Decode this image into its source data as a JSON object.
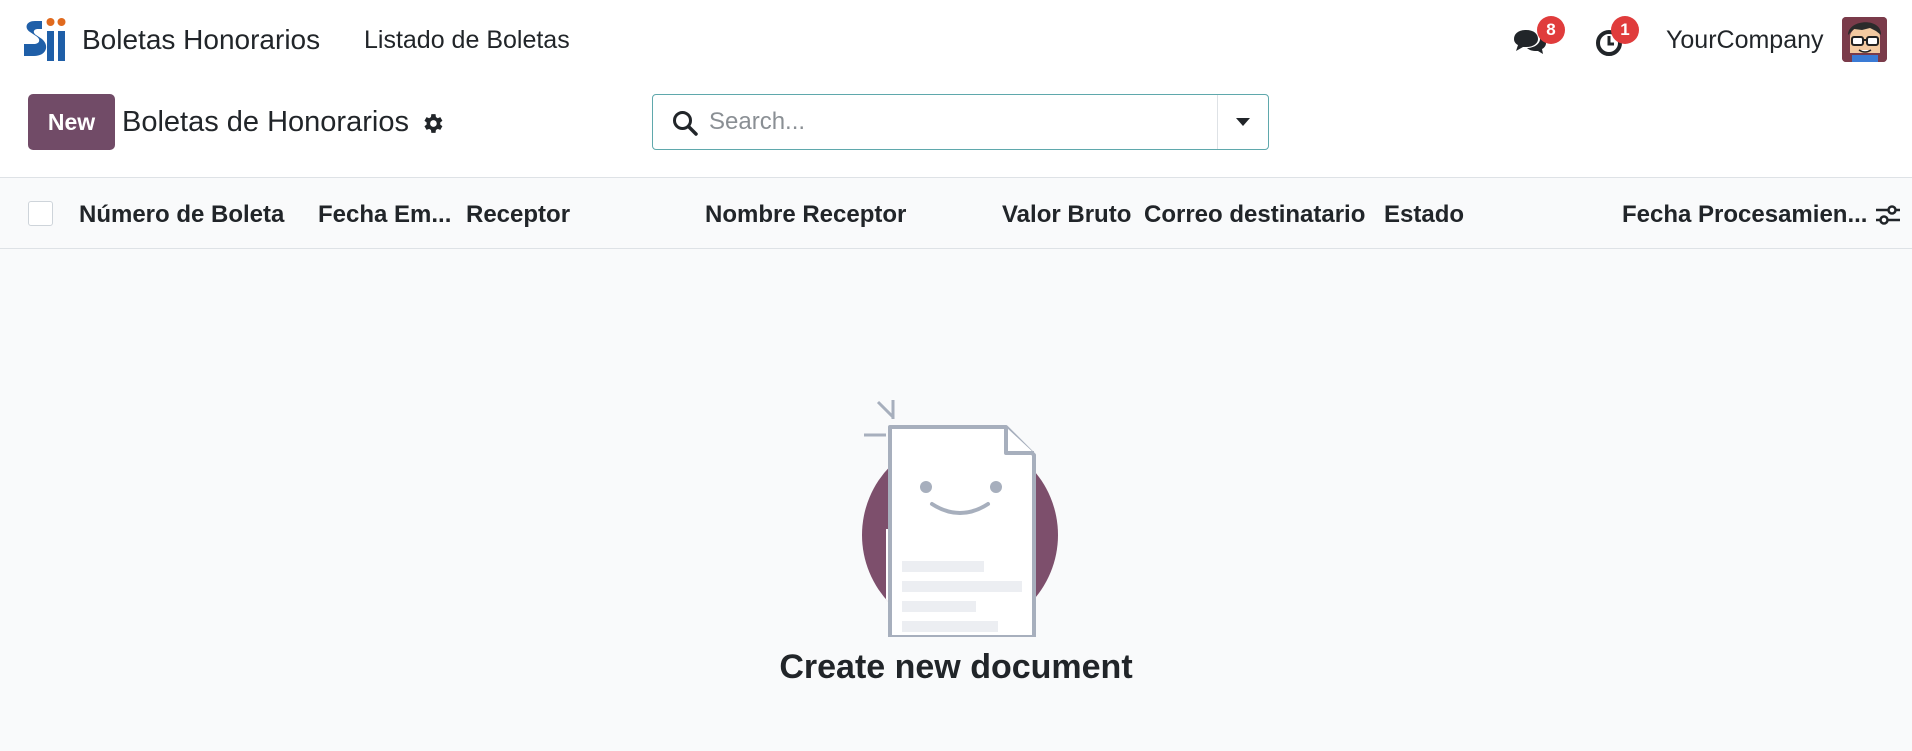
{
  "navbar": {
    "app_name": "Boletas Honorarios",
    "menu_item": "Listado de Boletas",
    "messages_count": "8",
    "activities_count": "1",
    "company": "YourCompany"
  },
  "control_panel": {
    "new_label": "New",
    "title": "Boletas de Honorarios",
    "search_placeholder": "Search..."
  },
  "table": {
    "columns": [
      "Número de Boleta",
      "Fecha Em...",
      "Receptor",
      "Nombre Receptor",
      "Valor Bruto",
      "Correo destinatario",
      "Estado",
      "Fecha Procesamien..."
    ]
  },
  "empty_state": {
    "title": "Create new document"
  },
  "colors": {
    "brand": "#714b67",
    "badge": "#e03c3c",
    "logo_blue": "#1f5fa8",
    "logo_orange": "#e06a1e"
  }
}
